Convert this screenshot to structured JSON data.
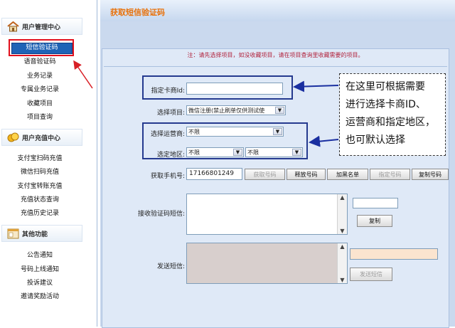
{
  "sidebar": {
    "sections": [
      {
        "title": "用户管理中心",
        "icon": "house-icon",
        "items": [
          "短信验证码",
          "语音验证码",
          "业务记录",
          "专属业务记录",
          "收藏项目",
          "项目查询"
        ]
      },
      {
        "title": "用户充值中心",
        "icon": "coins-icon",
        "items": [
          "支付宝扫码充值",
          "微信扫码充值",
          "支付宝转账充值",
          "充值状态查询",
          "充值历史记录"
        ]
      },
      {
        "title": "其他功能",
        "icon": "window-icon",
        "items": [
          "公告通知",
          "号码上线通知",
          "投诉建议",
          "邀请奖励活动"
        ]
      }
    ],
    "active_item": "短信验证码"
  },
  "page": {
    "title": "获取短信验证码",
    "notice": "注：请先选择项目，如没收藏项目，请在项目查询里收藏需要的项目。"
  },
  "form": {
    "carrier_id_label": "指定卡商Id:",
    "carrier_id_value": "",
    "project_label": "选择项目:",
    "project_value": "微信注册(禁止刷单仅供测试使",
    "operator_label": "选择运营商:",
    "operator_value": "不限",
    "region_label": "选定地区:",
    "region_value1": "不限",
    "region_value2": "不限",
    "phone_label": "获取手机号:",
    "phone_value": "17166801249",
    "buttons": {
      "get_number": "获取号码",
      "release_number": "释放号码",
      "blacklist": "加黑名单",
      "assign_number": "指定号码",
      "copy_number": "复制号码"
    },
    "sms_label": "接收验证码短信:",
    "sms_value": "",
    "code_value": "",
    "copy_button": "复制",
    "send_label": "发送短信:",
    "send_target": "",
    "send_button": "发送短信"
  },
  "callout": {
    "lines": [
      "在这里可根据需要",
      "进行选择卡商ID、",
      "运营商和指定地区，",
      "也可默认选择"
    ]
  },
  "colors": {
    "title_orange": "#e8720c",
    "highlight_red": "#e1101d",
    "box_blue": "#253a8f",
    "panel_bg": "#dfe9f7",
    "main_bg": "#cad9ee"
  }
}
